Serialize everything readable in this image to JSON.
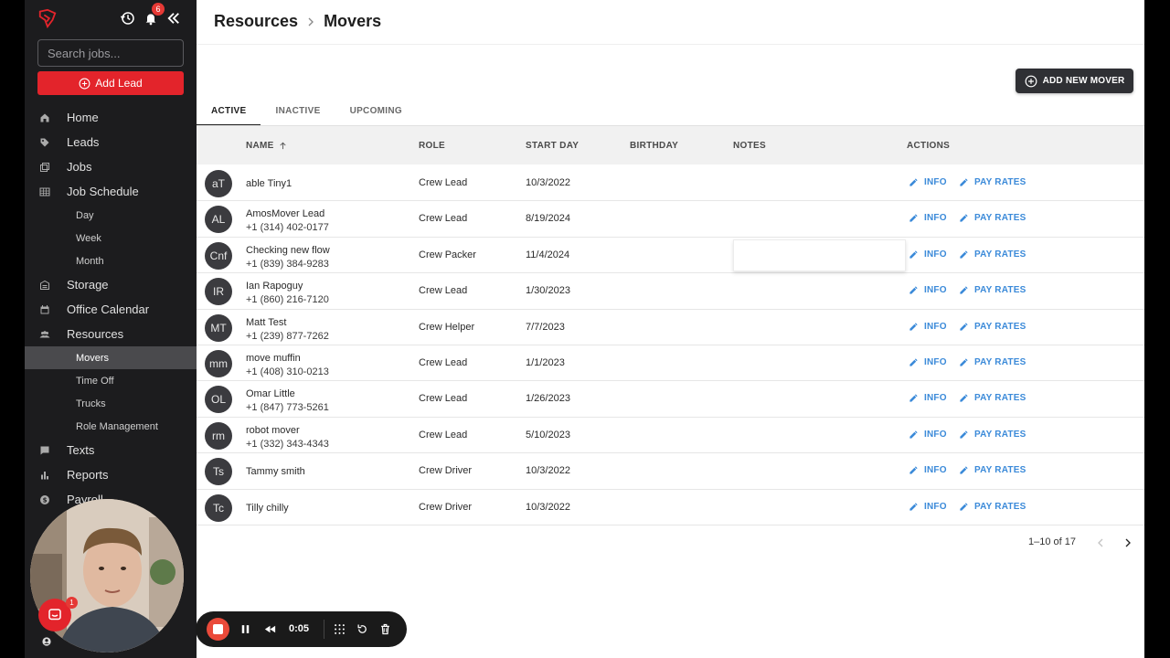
{
  "sidebar": {
    "notifications_count": "6",
    "search_placeholder": "Search jobs...",
    "add_lead_label": "Add Lead",
    "nav": [
      {
        "label": "Home",
        "icon": "home-icon"
      },
      {
        "label": "Leads",
        "icon": "tag-icon"
      },
      {
        "label": "Jobs",
        "icon": "jobs-icon"
      },
      {
        "label": "Job Schedule",
        "icon": "calendar-grid-icon"
      }
    ],
    "schedule_sub": [
      "Day",
      "Week",
      "Month"
    ],
    "nav2": [
      {
        "label": "Storage",
        "icon": "storage-icon"
      },
      {
        "label": "Office Calendar",
        "icon": "calendar-icon"
      },
      {
        "label": "Resources",
        "icon": "people-icon"
      }
    ],
    "resources_sub": [
      "Movers",
      "Time Off",
      "Trucks",
      "Role Management"
    ],
    "nav3": [
      {
        "label": "Texts",
        "icon": "chat-icon"
      },
      {
        "label": "Reports",
        "icon": "bar-chart-icon"
      },
      {
        "label": "Payroll",
        "icon": "dollar-icon"
      }
    ]
  },
  "header": {
    "breadcrumb_parent": "Resources",
    "breadcrumb_current": "Movers",
    "add_button": "ADD NEW MOVER"
  },
  "tabs": [
    "ACTIVE",
    "INACTIVE",
    "UPCOMING"
  ],
  "columns": {
    "name": "NAME",
    "role": "ROLE",
    "start_day": "START DAY",
    "birthday": "BIRTHDAY",
    "notes": "NOTES",
    "actions": "ACTIONS"
  },
  "action_labels": {
    "info": "INFO",
    "pay_rates": "PAY RATES"
  },
  "movers": [
    {
      "initials": "aT",
      "name": "able Tiny1",
      "phone": "",
      "role": "Crew Lead",
      "start": "10/3/2022"
    },
    {
      "initials": "AL",
      "name": "AmosMover Lead",
      "phone": "+1 (314) 402-0177",
      "role": "Crew Lead",
      "start": "8/19/2024"
    },
    {
      "initials": "Cnf",
      "name": "Checking new flow",
      "phone": "+1 (839) 384-9283",
      "role": "Crew Packer",
      "start": "11/4/2024"
    },
    {
      "initials": "IR",
      "name": "Ian Rapoguy",
      "phone": "+1 (860) 216-7120",
      "role": "Crew Lead",
      "start": "1/30/2023"
    },
    {
      "initials": "MT",
      "name": "Matt Test",
      "phone": "+1 (239) 877-7262",
      "role": "Crew Helper",
      "start": "7/7/2023"
    },
    {
      "initials": "mm",
      "name": "move muffin",
      "phone": "+1 (408) 310-0213",
      "role": "Crew Lead",
      "start": "1/1/2023"
    },
    {
      "initials": "OL",
      "name": "Omar Little",
      "phone": "+1 (847) 773-5261",
      "role": "Crew Lead",
      "start": "1/26/2023"
    },
    {
      "initials": "rm",
      "name": "robot mover",
      "phone": "+1 (332) 343-4343",
      "role": "Crew Lead",
      "start": "5/10/2023"
    },
    {
      "initials": "Ts",
      "name": "Tammy smith",
      "phone": "",
      "role": "Crew Driver",
      "start": "10/3/2022"
    },
    {
      "initials": "Tc",
      "name": "Tilly chilly",
      "phone": "",
      "role": "Crew Driver",
      "start": "10/3/2022"
    }
  ],
  "pagination": {
    "range": "1–10 of 17"
  },
  "webcam": {
    "chat_badge": "1"
  },
  "recorder": {
    "time": "0:05"
  },
  "colors": {
    "brand_red": "#e3242b",
    "action_blue": "#3b8ad9",
    "sidebar_bg": "#1c1c1e"
  }
}
